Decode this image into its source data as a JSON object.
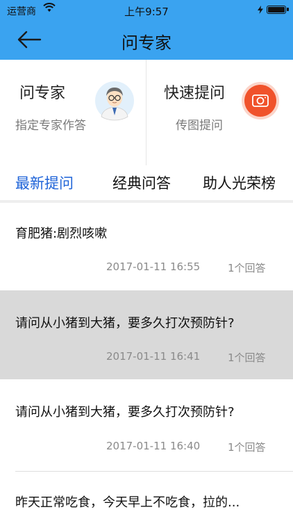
{
  "status_bar": {
    "carrier": "运营商",
    "time": "上午9:57",
    "battery_level": 0.95
  },
  "nav": {
    "title": "问专家",
    "back_icon": "arrow-left-icon"
  },
  "features": [
    {
      "title": "问专家",
      "subtitle": "指定专家作答",
      "icon": "expert-avatar-icon"
    },
    {
      "title": "快速提问",
      "subtitle": "传图提问",
      "icon": "camera-icon",
      "accent": "#f0522b"
    }
  ],
  "tabs": [
    {
      "label": "最新提问",
      "active": true
    },
    {
      "label": "经典问答",
      "active": false
    },
    {
      "label": "助人光荣榜",
      "active": false
    }
  ],
  "colors": {
    "nav_blue": "#3aa3f0",
    "active_tab": "#1e63d8",
    "highlight_row": "#d9d9d9"
  },
  "questions": [
    {
      "text": "育肥猪:剧烈咳嗽",
      "datetime": "2017-01-11 16:55",
      "answers": "1个回答",
      "highlighted": false
    },
    {
      "text": "请问从小猪到大猪，要多久打次预防针?",
      "datetime": "2017-01-11 16:41",
      "answers": "1个回答",
      "highlighted": true
    },
    {
      "text": "请问从小猪到大猪，要多久打次预防针?",
      "datetime": "2017-01-11 16:40",
      "answers": "1个回答",
      "highlighted": false
    },
    {
      "text": "昨天正常吃食，今天早上不吃食，拉的...",
      "datetime": "",
      "answers": "",
      "highlighted": false
    }
  ]
}
